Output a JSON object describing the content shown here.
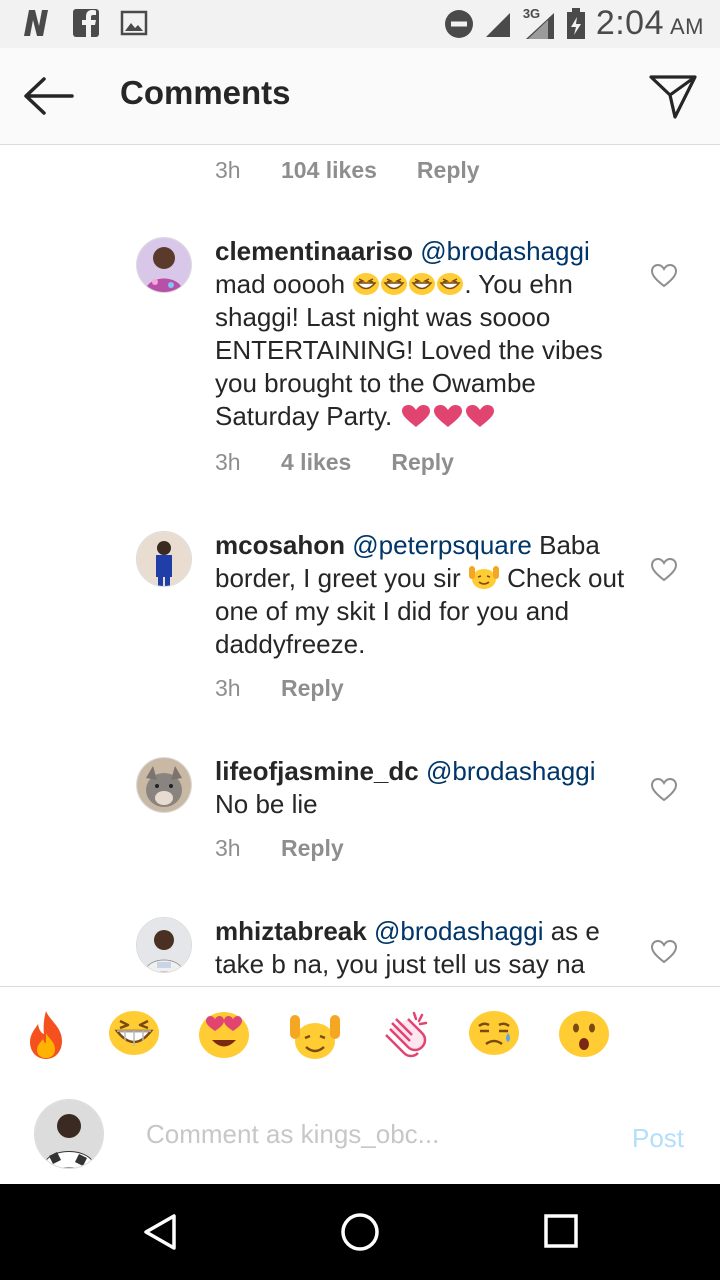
{
  "status_bar": {
    "time": "2:04",
    "ampm": "AM",
    "network": "3G",
    "icons": [
      "notification-n-icon",
      "facebook-icon",
      "image-icon",
      "do-not-disturb-icon",
      "signal-icon",
      "signal-3g-icon",
      "battery-icon"
    ]
  },
  "header": {
    "title": "Comments",
    "back_icon": "arrow-left-icon",
    "share_icon": "paper-plane-icon"
  },
  "top_meta": {
    "time": "3h",
    "likes": "104 likes",
    "reply": "Reply"
  },
  "comments": [
    {
      "username": "clementinaariso",
      "mention": "@brodashaggi",
      "text_a": "mad ooooh ",
      "text_b": ". You ehn shaggi! Last night was soooo ENTERTAINING! Loved the vibes you brought to the Owambe Saturday Party. ",
      "time": "3h",
      "likes": "4 likes",
      "reply": "Reply"
    },
    {
      "username": "mcosahon",
      "mention": "@peterpsquare",
      "text_a": " Baba border, I greet you sir ",
      "text_b": " Check out one of my skit I did for you and daddyfreeze.",
      "time": "3h",
      "reply": "Reply"
    },
    {
      "username": "lifeofjasmine_dc",
      "mention": "@brodashaggi",
      "text_a": " No be lie",
      "time": "3h",
      "reply": "Reply"
    },
    {
      "username": "mhiztabreak",
      "mention": "@brodashaggi",
      "text_a": " as e take b na, you just tell us say na"
    }
  ],
  "emoji_bar": [
    "fire",
    "grinning-squint",
    "heart-eyes",
    "raised-hands",
    "clapping-hands",
    "crying",
    "surprised"
  ],
  "composer": {
    "placeholder": "Comment as kings_obc...",
    "post_label": "Post"
  },
  "colors": {
    "mention": "#003569",
    "meta": "#8e8e8e",
    "post_disabled": "#b2dffc",
    "heart": "#e24472"
  }
}
